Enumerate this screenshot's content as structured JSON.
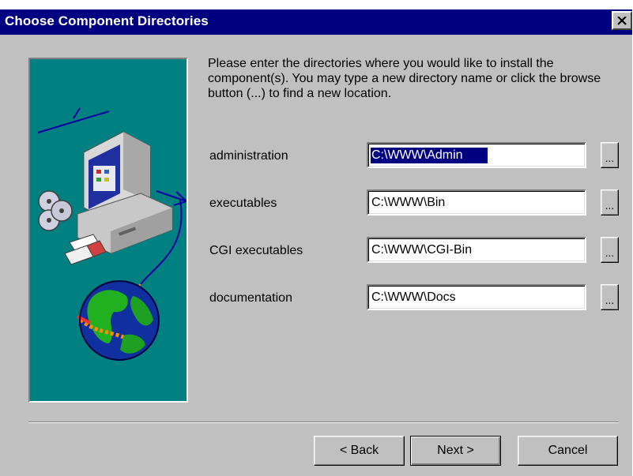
{
  "window": {
    "title": "Choose Component Directories",
    "close_icon": "close-icon"
  },
  "intro_text": "Please enter the directories where you would like to install the component(s).  You may type a new directory name or click the browse button (...) to find a new location.",
  "illustration": "computer-globe-network-illustration",
  "components": [
    {
      "label": "administration",
      "path": "C:\\WWW\\Admin",
      "browse_label": "...",
      "selected": true
    },
    {
      "label": "executables",
      "path": "C:\\WWW\\Bin",
      "browse_label": "..."
    },
    {
      "label": "CGI executables",
      "path": "C:\\WWW\\CGI-Bin",
      "browse_label": "..."
    },
    {
      "label": "documentation",
      "path": "C:\\WWW\\Docs",
      "browse_label": "..."
    }
  ],
  "buttons": {
    "back": "< Back",
    "next": "Next >",
    "cancel": "Cancel"
  },
  "colors": {
    "title_bar": "#000080",
    "dialog_face": "#c0c0c0",
    "illustration_bg": "#008080",
    "selection": "#000080"
  }
}
